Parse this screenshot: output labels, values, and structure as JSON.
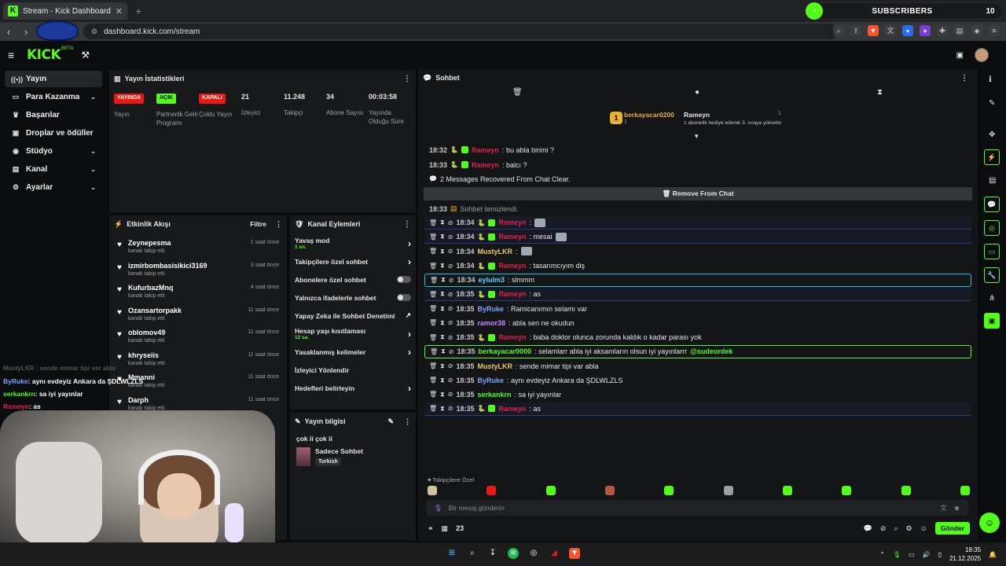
{
  "browser": {
    "tab_title": "Stream - Kick Dashboard",
    "url": "dashboard.kick.com/stream",
    "subs_label": "SUBSCRIBERS",
    "subs_count": "10",
    "new_tab": "+"
  },
  "topbar": {
    "logo": "KICK",
    "logo_sub": "BETA"
  },
  "sidebar": {
    "items": [
      {
        "label": "Yayın",
        "icon": "broadcast-icon",
        "chevron": false
      },
      {
        "label": "Para Kazanma",
        "icon": "money-icon",
        "chevron": true
      },
      {
        "label": "Başarılar",
        "icon": "trophy-icon",
        "chevron": false
      },
      {
        "label": "Droplar ve ödüller",
        "icon": "gift-icon",
        "chevron": false
      },
      {
        "label": "Stüdyo",
        "icon": "studio-icon",
        "chevron": true
      },
      {
        "label": "Kanal",
        "icon": "channel-icon",
        "chevron": true
      },
      {
        "label": "Ayarlar",
        "icon": "settings-icon",
        "chevron": true
      }
    ]
  },
  "stats": {
    "title": "Yayın İstatistikleri",
    "items": [
      {
        "badge": "YAYINDA",
        "label": "Yayın",
        "color": "#e91916"
      },
      {
        "badge": "AÇIK",
        "label": "Partnerlik Gelir Programı",
        "color": "#53fc18"
      },
      {
        "badge": "KAPALI",
        "label": "Çoklu Yayın",
        "color": "#e91916"
      },
      {
        "value": "21",
        "label": "İzleyici"
      },
      {
        "value": "11.248",
        "label": "Takipçi"
      },
      {
        "value": "34",
        "label": "Abone Sayısı"
      },
      {
        "value": "00:03:58",
        "label": "Yayında Olduğu Süre"
      }
    ]
  },
  "events": {
    "title": "Etkinlik Akışı",
    "filter": "Filtre",
    "rows": [
      {
        "name": "Zeynepesma",
        "sub": "kanalı takip etti",
        "time": "1 saat önce"
      },
      {
        "name": "izmirbombasisikici3169",
        "sub": "kanalı takip etti",
        "time": "3 saat önce"
      },
      {
        "name": "KufurbazMnq",
        "sub": "kanalı takip etti",
        "time": "4 saat önce"
      },
      {
        "name": "Ozansartorpakk",
        "sub": "kanalı takip etti",
        "time": "11 saat önce"
      },
      {
        "name": "oblomov49",
        "sub": "kanalı takip etti",
        "time": "11 saat önce"
      },
      {
        "name": "khryseiis",
        "sub": "kanalı takip etti",
        "time": "11 saat önce"
      },
      {
        "name": "Mmanni",
        "sub": "kanalı takip etti",
        "time": "11 saat önce"
      },
      {
        "name": "Darph",
        "sub": "kanalı takip etti",
        "time": "11 saat önce"
      }
    ]
  },
  "actions": {
    "title": "Kanal Eylemleri",
    "rows": [
      {
        "label": "Yavaş mod",
        "sub": "1 sn.",
        "type": "chevron"
      },
      {
        "label": "Takipçilere özel sohbet",
        "type": "chevron"
      },
      {
        "label": "Abonelere özel sohbet",
        "type": "toggle"
      },
      {
        "label": "Yalnızca ifadelerle sohbet",
        "type": "toggle"
      },
      {
        "label": "Yapay Zeka ile Sohbet Denetimi",
        "type": "link"
      },
      {
        "label": "Hesap yaşı kısıtlaması",
        "sub": "12 sa.",
        "type": "chevron"
      },
      {
        "label": "Yasaklanmış kelimeler",
        "type": "chevron"
      },
      {
        "label": "İzleyici Yönlendir",
        "type": "none"
      },
      {
        "label": "Hedefleri belirleyin",
        "type": "chevron"
      }
    ]
  },
  "info": {
    "title": "Yayın bilgisi",
    "stream_title": "çok ii çok ii",
    "category": "Sadece Sohbet",
    "language": "Turkish"
  },
  "chat": {
    "title": "Sohbet",
    "pinned": {
      "user": "berkayacar0200",
      "user_count": "1",
      "gifter": "Rameyn",
      "gifter_count": "1",
      "note": "1 abonelik hediye ederek 3. sıraya yükselin"
    },
    "recovered": "2 Messages Recovered From Chat Clear.",
    "remove": "Remove From Chat",
    "cleared": {
      "time": "18:33",
      "text": "Sohbet temizlendi."
    },
    "pre_messages": [
      {
        "time": "18:32",
        "user": "Rameyn",
        "text": ": bu abla birimi ?",
        "color": "#e0204a"
      },
      {
        "time": "18:33",
        "user": "Rameyn",
        "text": ": balcı ?",
        "color": "#e0204a"
      }
    ],
    "messages": [
      {
        "time": "18:34",
        "user": "Rameyn",
        "text": ":",
        "color": "#e0204a",
        "emote": true,
        "hl": "blue"
      },
      {
        "time": "18:34",
        "user": "Rameyn",
        "text": ": mesai",
        "color": "#e0204a",
        "emote": true,
        "hl": "blue"
      },
      {
        "time": "18:34",
        "user": "MustyLKR",
        "text": ":",
        "color": "#e8c96a",
        "emote": true,
        "hl": ""
      },
      {
        "time": "18:34",
        "user": "Rameyn",
        "text": ": tasarımcıyım diş",
        "color": "#e0204a",
        "emote": false,
        "hl": ""
      },
      {
        "time": "18:34",
        "user": "eylulm3",
        "text": ": slmmm",
        "color": "#53d6ff",
        "emote": false,
        "hl": "cyan"
      },
      {
        "time": "18:35",
        "user": "Rameyn",
        "text": ": as",
        "color": "#e0204a",
        "emote": false,
        "hl": "blue"
      },
      {
        "time": "18:35",
        "user": "ByRuke",
        "text": ": Ramicanımın selamı var",
        "color": "#7aa6ff",
        "emote": false,
        "hl": ""
      },
      {
        "time": "18:35",
        "user": "ramor38",
        "text": ": abla sen ne okudun",
        "color": "#c68bff",
        "emote": false,
        "hl": ""
      },
      {
        "time": "18:35",
        "user": "Rameyn",
        "text": ": baba doktor olunca zorunda kaldık o kadar parası yok",
        "color": "#e0204a",
        "emote": false,
        "hl": ""
      },
      {
        "time": "18:35",
        "user": "berkayacar0000",
        "text": ": selamlarr abla iyi aksamların olsun iyi yayınlarrr",
        "mention": "@sudeordek",
        "color": "#53fc18",
        "emote": false,
        "hl": "green"
      },
      {
        "time": "18:35",
        "user": "MustyLKR",
        "text": ": sende mimar tipi var abla",
        "color": "#e8c96a",
        "emote": false,
        "hl": ""
      },
      {
        "time": "18:35",
        "user": "ByRuke",
        "text": ": aynı evdeyiz Ankara da ŞDLWLZLS",
        "color": "#7aa6ff",
        "emote": false,
        "hl": ""
      },
      {
        "time": "18:35",
        "user": "serkankrn",
        "text": ": sa iyi yayınlar",
        "color": "#53fc18",
        "emote": false,
        "hl": ""
      },
      {
        "time": "18:35",
        "user": "Rameyn",
        "text": ": as",
        "color": "#e0204a",
        "emote": false,
        "hl": "blue"
      }
    ],
    "followers_only": "Takipçilere Özel",
    "input_placeholder": "Bir mesaj gönderin",
    "viewer_count": "23",
    "send": "Gönder"
  },
  "overlay_chat": [
    {
      "user": "ByRuke",
      "text": ": aynı evdeyiz Ankara da ŞDLWLZLS",
      "color": "#7aa6ff"
    },
    {
      "user": "serkankrn",
      "text": ": sa iyi yayınlar",
      "color": "#53fc18"
    },
    {
      "user": "Rameyn",
      "text": ": as",
      "color": "#e0204a"
    }
  ],
  "overlay_faded": "MustyLKR : sende mimar tipi var abla",
  "taskbar": {
    "time": "18:35",
    "date": "21.12.2025"
  }
}
